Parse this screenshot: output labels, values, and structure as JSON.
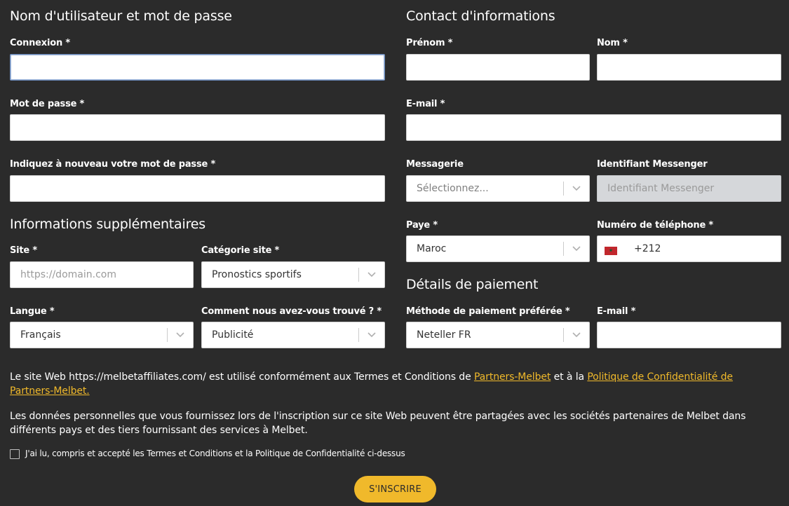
{
  "left": {
    "credentials_title": "Nom d'utilisateur et mot de passe",
    "login_label": "Connexion *",
    "password_label": "Mot de passe *",
    "password_repeat_label": "Indiquez à nouveau votre mot de passe *",
    "additional_title": "Informations supplémentaires",
    "site_label": "Site *",
    "site_placeholder": "https://domain.com",
    "site_category_label": "Catégorie site *",
    "site_category_value": "Pronostics sportifs",
    "language_label": "Langue *",
    "language_value": "Français",
    "source_label": "Comment nous avez-vous trouvé ? *",
    "source_value": "Publicité"
  },
  "right": {
    "contact_title": "Contact d'informations",
    "first_name_label": "Prénom *",
    "last_name_label": "Nom *",
    "email_label": "E-mail *",
    "messenger_label": "Messagerie",
    "messenger_placeholder": "Sélectionnez...",
    "messenger_id_label": "Identifiant Messenger",
    "messenger_id_placeholder": "Identifiant Messenger",
    "country_label": "Paye *",
    "country_value": "Maroc",
    "phone_label": "Numéro de téléphone *",
    "phone_code": "+212",
    "payment_title": "Détails de paiement",
    "payment_method_label": "Méthode de paiement préférée *",
    "payment_method_value": "Neteller FR",
    "payment_email_label": "E-mail *"
  },
  "terms": {
    "p1_a": "Le site Web https://melbetaffiliates.com/ est utilisé conformément aux Termes et Conditions de ",
    "p1_link1": "Partners-Melbet",
    "p1_b": " et à la ",
    "p1_link2": "Politique de Confidentialité de Partners-Melbet.",
    "p2": "Les données personnelles que vous fournissez lors de l'inscription sur ce site Web peuvent être partagées avec les sociétés partenaires de Melbet dans différents pays et des tiers fournissant des services à Melbet.",
    "checkbox_label": "J'ai lu, compris et accepté les Termes et Conditions et la Politique de Confidentialité ci-dessus"
  },
  "submit_label": "S'INSCRIRE",
  "colors": {
    "background": "#2b2b2b",
    "accent": "#f0b92b",
    "disabled_field": "#d5d7da"
  },
  "icons": {
    "dropdown": "chevron-down-icon",
    "flag": "morocco-flag-icon"
  }
}
